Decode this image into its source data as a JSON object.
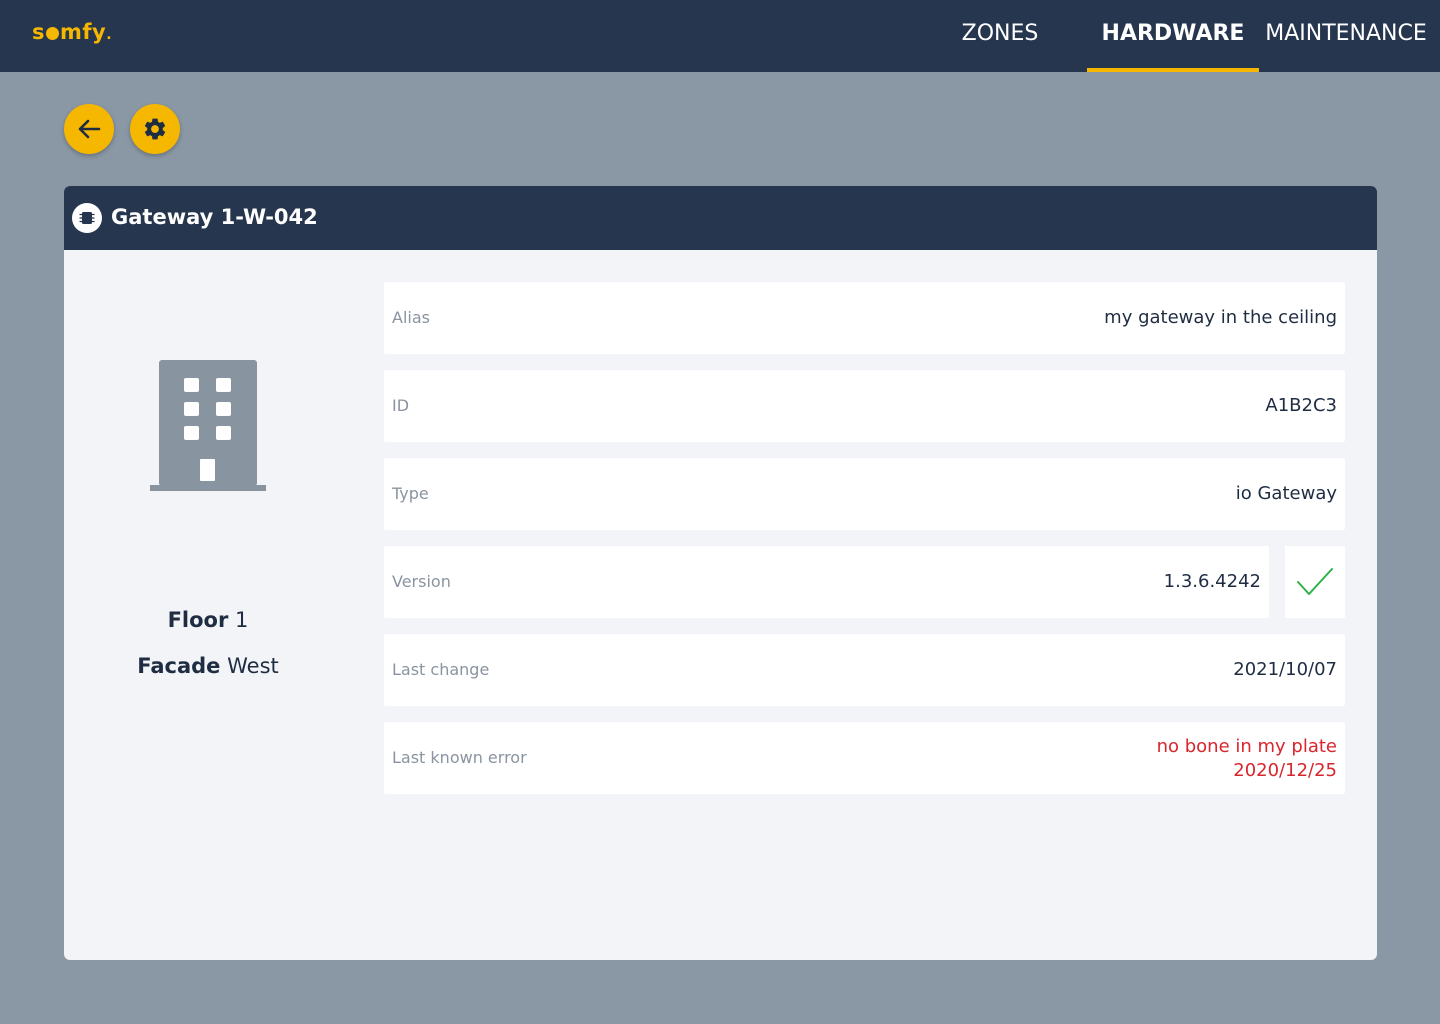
{
  "app": {
    "logo_text": "somfy."
  },
  "nav": {
    "tabs": [
      {
        "label": "ZONES",
        "active": false
      },
      {
        "label": "HARDWARE",
        "active": true
      },
      {
        "label": "MAINTENANCE",
        "active": false
      }
    ]
  },
  "toolbar": {
    "back_icon": "arrow-left-icon",
    "settings_icon": "gear-icon"
  },
  "card": {
    "title": "Gateway 1-W-042",
    "title_icon": "chip-icon",
    "building_icon": "building-icon",
    "location": {
      "floor_label": "Floor",
      "floor_value": "1",
      "facade_label": "Facade",
      "facade_value": "West"
    },
    "fields": [
      {
        "label": "Alias",
        "value": "my gateway in the ceiling"
      },
      {
        "label": "ID",
        "value": "A1B2C3"
      },
      {
        "label": "Type",
        "value": "io Gateway"
      },
      {
        "label": "Version",
        "value": "1.3.6.4242",
        "status_icon": "check-icon"
      },
      {
        "label": "Last change",
        "value": "2021/10/07"
      },
      {
        "label": "Last known error",
        "value_line1": "no bone in my plate",
        "value_line2": "2020/12/25"
      }
    ]
  },
  "colors": {
    "accent": "#f5b700",
    "header": "#26364f",
    "background": "#8a97a4",
    "error": "#d8262c",
    "ok": "#2bb34a"
  }
}
